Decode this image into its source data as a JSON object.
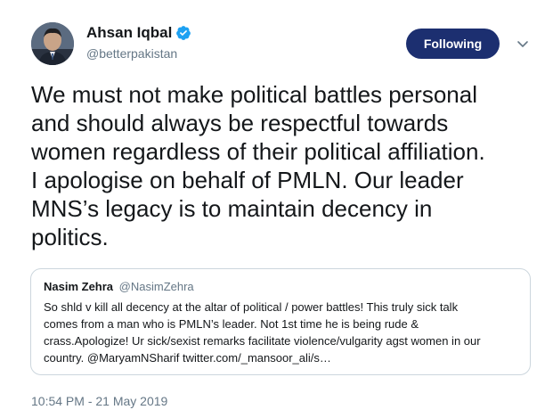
{
  "author": {
    "name": "Ahsan Iqbal",
    "handle": "@betterpakistan",
    "verified": true,
    "avatar_icon": "profile-photo"
  },
  "follow_button": {
    "label": "Following",
    "color": "#1c2f70"
  },
  "menu_icon": "chevron-down-icon",
  "tweet": {
    "lines": [
      "We must not make political battles personal",
      "and should always be respectful towards",
      "women regardless of their political affiliation.",
      "I apologise on behalf of PMLN. Our leader",
      "MNS’s legacy is to maintain decency in",
      "politics."
    ]
  },
  "quoted_tweet": {
    "name": "Nasim Zehra",
    "handle": "@NasimZehra",
    "lines": [
      "So shld v kill all decency at the altar of political / power battles! This truly sick talk",
      "comes from a man who is PMLN’s leader. Not 1st time he is being rude &",
      "crass.Apologize! Ur sick/sexist remarks facilitate violence/vulgarity agst women in our",
      "country. @MaryamNSharif twitter.com/_mansoor_ali/s…"
    ]
  },
  "timestamp": "10:54 PM - 21 May 2019",
  "colors": {
    "text": "#14171a",
    "secondary": "#657786",
    "border": "#ccd6dd",
    "verified": "#1da1f2"
  }
}
